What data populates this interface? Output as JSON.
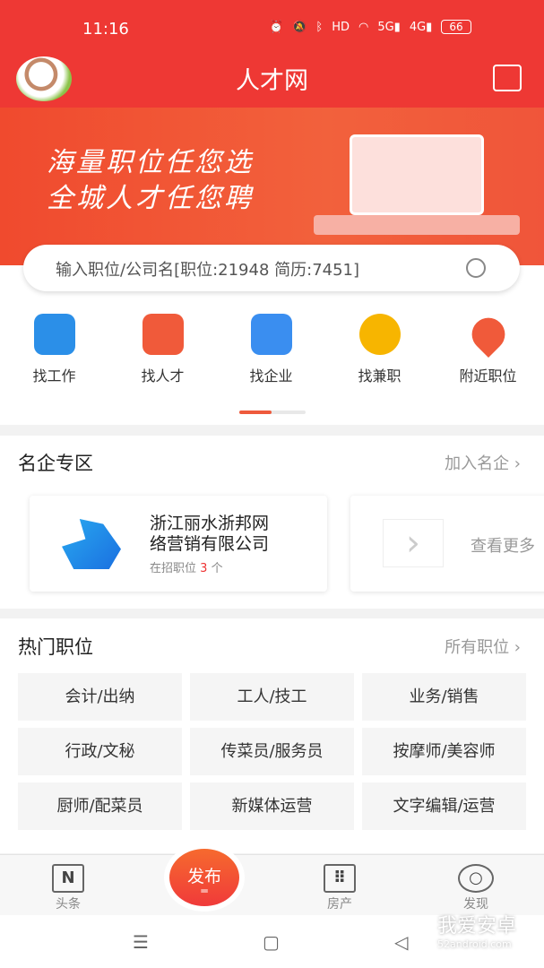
{
  "status_bar": {
    "time": "11:16",
    "icons": [
      "alarm-icon",
      "mute-icon",
      "bluetooth-icon",
      "hd-icon",
      "wifi-icon",
      "5g-signal-icon",
      "4g-signal-icon"
    ],
    "battery": "66",
    "hd": "HD"
  },
  "header": {
    "title": "人才网",
    "edit_icon": "edit-note-icon"
  },
  "banner": {
    "line1": "海量职位任您选",
    "line2": "全城人才任您聘"
  },
  "search": {
    "placeholder": "输入职位/公司名[职位:21948 简历:7451]"
  },
  "categories": [
    {
      "label": "找工作",
      "color": "#2b8fe8"
    },
    {
      "label": "找人才",
      "color": "#f05a3a"
    },
    {
      "label": "找企业",
      "color": "#3a8ef0"
    },
    {
      "label": "找兼职",
      "color": "#f7b500"
    },
    {
      "label": "附近职位",
      "color": "#f05a3a"
    }
  ],
  "famous": {
    "title": "名企专区",
    "more": "加入名企",
    "company": {
      "name_line1": "浙江丽水浙邦网",
      "name_line2": "络营销有限公司",
      "jobs_prefix": "在招职位",
      "jobs_count": "3",
      "jobs_suffix": "个"
    },
    "see_more": "查看更多"
  },
  "hot": {
    "title": "热门职位",
    "more": "所有职位",
    "tags": [
      "会计/出纳",
      "工人/技工",
      "业务/销售",
      "行政/文秘",
      "传菜员/服务员",
      "按摩师/美容师",
      "厨师/配菜员",
      "新媒体运营",
      "文字编辑/运营"
    ]
  },
  "tabbar": {
    "items": [
      {
        "label": "头条",
        "icon": "news-icon"
      },
      {
        "label": "发布",
        "icon": "publish-icon"
      },
      {
        "label": "房产",
        "icon": "building-icon"
      },
      {
        "label": "发现",
        "icon": "eye-icon"
      }
    ]
  },
  "watermark": {
    "text": "我爱安卓",
    "url": "52android.com"
  },
  "colors": {
    "primary": "#ee3834",
    "accent": "#f05a3a"
  }
}
